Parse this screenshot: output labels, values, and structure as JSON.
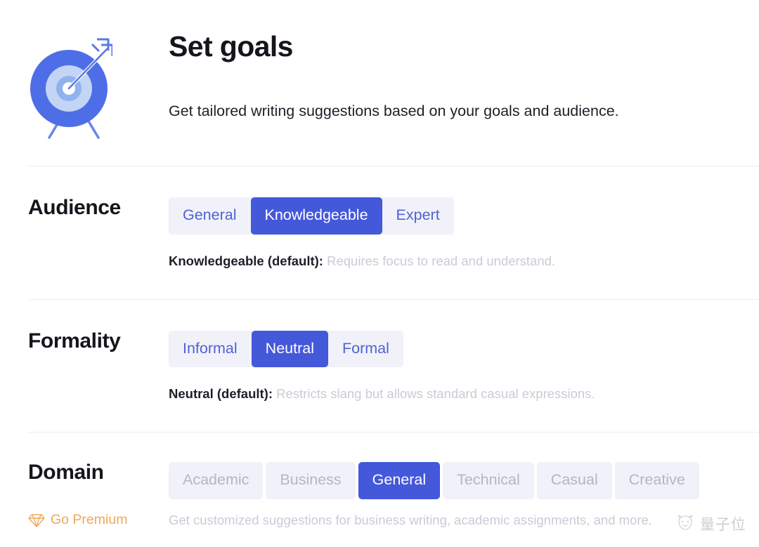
{
  "header": {
    "icon": "target-arrow-icon",
    "title": "Set goals",
    "subtitle": "Get tailored writing suggestions based on your goals and audience."
  },
  "settings": [
    {
      "label": "Audience",
      "control": "segmented",
      "options": [
        {
          "label": "General",
          "selected": false
        },
        {
          "label": "Knowledgeable",
          "selected": true
        },
        {
          "label": "Expert",
          "selected": false
        }
      ],
      "hint_strong": "Knowledgeable (default):",
      "hint_text": " Requires focus to read and understand."
    },
    {
      "label": "Formality",
      "control": "segmented",
      "options": [
        {
          "label": "Informal",
          "selected": false
        },
        {
          "label": "Neutral",
          "selected": true
        },
        {
          "label": "Formal",
          "selected": false
        }
      ],
      "hint_strong": "Neutral (default):",
      "hint_text": " Restricts slang but allows standard casual expressions."
    },
    {
      "label": "Domain",
      "control": "pills",
      "options": [
        {
          "label": "Academic",
          "selected": false
        },
        {
          "label": "Business",
          "selected": false
        },
        {
          "label": "General",
          "selected": true
        },
        {
          "label": "Technical",
          "selected": false
        },
        {
          "label": "Casual",
          "selected": false
        },
        {
          "label": "Creative",
          "selected": false
        }
      ]
    }
  ],
  "premium": {
    "icon": "diamond-icon",
    "label": "Go Premium",
    "description": "Get customized suggestions for business writing, academic assignments, and more."
  },
  "watermark": {
    "icon": "cat-logo-icon",
    "text": "量子位"
  },
  "colors": {
    "accent_blue": "#4458da",
    "track_lavender": "#f1f1f9",
    "option_blue_text": "#4f63d2",
    "disabled_text": "#b3b6c4",
    "hint_gray": "#c9ccd6",
    "premium_gold": "#f0a85c",
    "divider": "#edeef2",
    "title_dark": "#15161c"
  }
}
